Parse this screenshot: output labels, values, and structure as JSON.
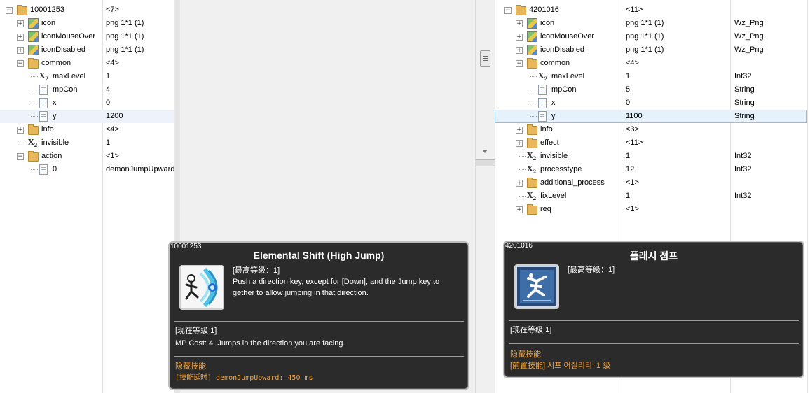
{
  "left_tree": {
    "rows": [
      {
        "name": "10001253",
        "value": "<7>",
        "type": "",
        "icon": "folder",
        "level": 0,
        "exp": "-"
      },
      {
        "name": "icon",
        "value": "png 1*1 (1)",
        "type": "",
        "icon": "png",
        "level": 1,
        "exp": "+"
      },
      {
        "name": "iconMouseOver",
        "value": "png 1*1 (1)",
        "type": "",
        "icon": "png",
        "level": 1,
        "exp": "+"
      },
      {
        "name": "iconDisabled",
        "value": "png 1*1 (1)",
        "type": "",
        "icon": "png",
        "level": 1,
        "exp": "+"
      },
      {
        "name": "common",
        "value": "<4>",
        "type": "",
        "icon": "folder",
        "level": 1,
        "exp": "-"
      },
      {
        "name": "maxLevel",
        "value": "1",
        "type": "",
        "icon": "int",
        "level": 2,
        "exp": ""
      },
      {
        "name": "mpCon",
        "value": "4",
        "type": "",
        "icon": "str",
        "level": 2,
        "exp": ""
      },
      {
        "name": "x",
        "value": "0",
        "type": "",
        "icon": "str",
        "level": 2,
        "exp": ""
      },
      {
        "name": "y",
        "value": "1200",
        "type": "",
        "icon": "str",
        "level": 2,
        "exp": "",
        "selected": true
      },
      {
        "name": "info",
        "value": "<4>",
        "type": "",
        "icon": "folder",
        "level": 1,
        "exp": "+"
      },
      {
        "name": "invisible",
        "value": "1",
        "type": "",
        "icon": "int",
        "level": 1,
        "exp": ""
      },
      {
        "name": "action",
        "value": "<1>",
        "type": "",
        "icon": "folder",
        "level": 1,
        "exp": "-"
      },
      {
        "name": "0",
        "value": "demonJumpUpward",
        "type": "",
        "icon": "str",
        "level": 2,
        "exp": ""
      }
    ]
  },
  "right_tree": {
    "rows": [
      {
        "name": "4201016",
        "value": "<11>",
        "type": "",
        "icon": "folder",
        "level": 0,
        "exp": "-"
      },
      {
        "name": "icon",
        "value": "png 1*1 (1)",
        "type": "Wz_Png",
        "icon": "png",
        "level": 1,
        "exp": "+"
      },
      {
        "name": "iconMouseOver",
        "value": "png 1*1 (1)",
        "type": "Wz_Png",
        "icon": "png",
        "level": 1,
        "exp": "+"
      },
      {
        "name": "iconDisabled",
        "value": "png 1*1 (1)",
        "type": "Wz_Png",
        "icon": "png",
        "level": 1,
        "exp": "+"
      },
      {
        "name": "common",
        "value": "<4>",
        "type": "",
        "icon": "folder",
        "level": 1,
        "exp": "-"
      },
      {
        "name": "maxLevel",
        "value": "1",
        "type": "Int32",
        "icon": "int",
        "level": 2,
        "exp": ""
      },
      {
        "name": "mpCon",
        "value": "5",
        "type": "String",
        "icon": "str",
        "level": 2,
        "exp": ""
      },
      {
        "name": "x",
        "value": "0",
        "type": "String",
        "icon": "str",
        "level": 2,
        "exp": ""
      },
      {
        "name": "y",
        "value": "1100",
        "type": "String",
        "icon": "str",
        "level": 2,
        "exp": "",
        "selected": true
      },
      {
        "name": "info",
        "value": "<3>",
        "type": "",
        "icon": "folder",
        "level": 1,
        "exp": "+"
      },
      {
        "name": "effect",
        "value": "<11>",
        "type": "",
        "icon": "folder",
        "level": 1,
        "exp": "+"
      },
      {
        "name": "invisible",
        "value": "1",
        "type": "Int32",
        "icon": "int",
        "level": 1,
        "exp": ""
      },
      {
        "name": "processtype",
        "value": "12",
        "type": "Int32",
        "icon": "int",
        "level": 1,
        "exp": ""
      },
      {
        "name": "additional_process",
        "value": "<1>",
        "type": "",
        "icon": "folder",
        "level": 1,
        "exp": "+"
      },
      {
        "name": "fixLevel",
        "value": "1",
        "type": "Int32",
        "icon": "int",
        "level": 1,
        "exp": ""
      },
      {
        "name": "req",
        "value": "<1>",
        "type": "",
        "icon": "folder",
        "level": 1,
        "exp": "+"
      }
    ]
  },
  "tooltip_left": {
    "id": "10001253",
    "title": "Elemental Shift (High Jump)",
    "max_level": "[最高等级：1]",
    "desc_line1": "Push a direction key, except for [Down], and the Jump key to",
    "desc_line2": "gether to allow jumping in that direction.",
    "current_level": "[现在等级 1]",
    "current_desc": "MP Cost: 4. Jumps in the direction you are facing.",
    "hidden_skill": "隐藏技能",
    "delay": "[技能延时] demonJumpUpward: 450 ms"
  },
  "tooltip_right": {
    "id": "4201016",
    "title": "플래시 점프",
    "max_level": "[最高等级：1]",
    "current_level": "[现在等级 1]",
    "hidden_skill": "隐藏技能",
    "prereq": "[前置技能] 시프 어질리티: 1 级"
  },
  "colors": {
    "tooltip_bg": "#2b2b2b",
    "accent_orange": "#f1a23c",
    "selection_blue": "#8dc0e6"
  }
}
